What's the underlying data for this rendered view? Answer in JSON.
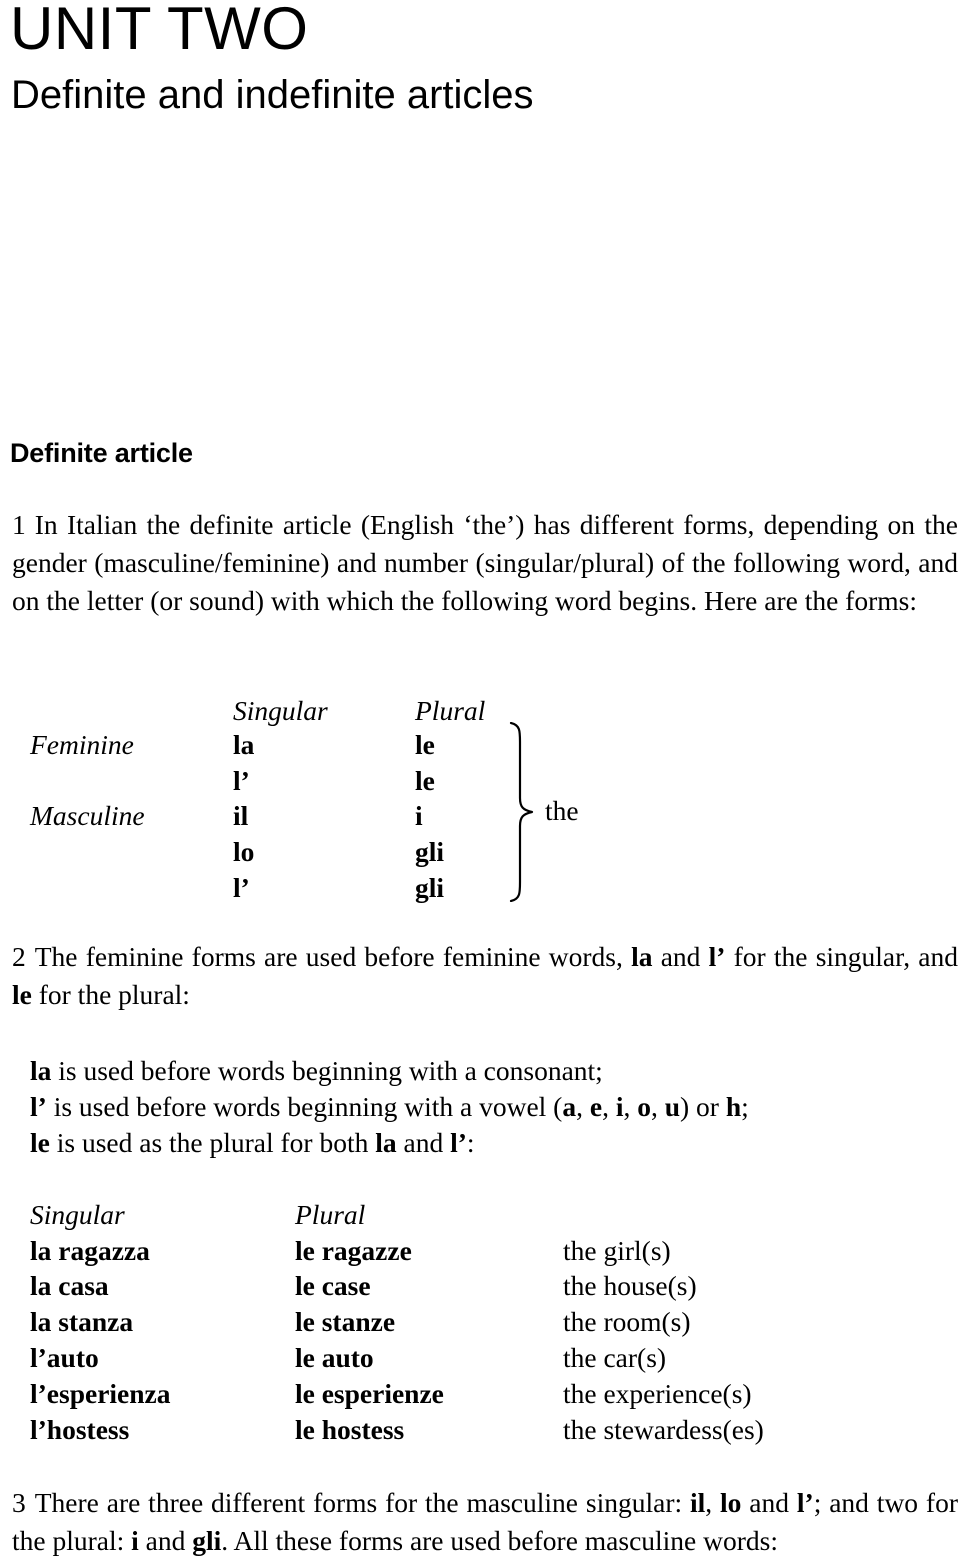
{
  "title": {
    "unit": "UNIT TWO",
    "subtitle": "Definite and indefinite articles"
  },
  "section": {
    "heading": "Definite article"
  },
  "paragraphs": {
    "p1": {
      "number": "1",
      "text": "In Italian the definite article (English ‘the’) has different forms, depending on the gender (masculine/feminine) and number (singular/plural) of the following word, and on the letter (or sound) with which the following word begins. Here are the forms:"
    },
    "p2": {
      "number": "2",
      "part1": "The feminine forms are used before feminine words, ",
      "b1": "la",
      "part2": " and ",
      "b2": "l’",
      "part3": " for the singular, and ",
      "b3": "le",
      "part4": " for the plural:"
    },
    "p3": {
      "number": "3",
      "part1": "There are three different forms for the masculine singular: ",
      "b1": "il",
      "part2": ", ",
      "b2": "lo",
      "part3": " and ",
      "b3": "l’",
      "part4": "; and two for the plural: ",
      "b4": "i",
      "part5": " and ",
      "b5": "gli",
      "part6": ". All these forms are used before masculine words:"
    }
  },
  "forms_table": {
    "header_singular": "Singular",
    "header_plural": "Plural",
    "rows": [
      {
        "label": "Feminine",
        "singular": "la",
        "plural": "le"
      },
      {
        "label": "",
        "singular": "l’",
        "plural": "le"
      },
      {
        "label": "Masculine",
        "singular": "il",
        "plural": "i"
      },
      {
        "label": "",
        "singular": "lo",
        "plural": "gli"
      },
      {
        "label": "",
        "singular": "l’",
        "plural": "gli"
      }
    ],
    "brace_label": "the"
  },
  "rules": {
    "line1": {
      "b1": "la",
      "t1": " is used before words beginning with a consonant;"
    },
    "line2": {
      "b1": "l’",
      "t1": " is used before words beginning with a vowel (",
      "b2": "a",
      "t2": ", ",
      "b3": "e",
      "t3": ", ",
      "b4": "i",
      "t4": ", ",
      "b5": "o",
      "t5": ", ",
      "b6": "u",
      "t6": ") or ",
      "b7": "h",
      "t7": ";"
    },
    "line3": {
      "b1": "le",
      "t1": " is used as the plural for both ",
      "b2": "la",
      "t2": " and ",
      "b3": "l’",
      "t3": ":"
    }
  },
  "examples_table": {
    "header_singular": "Singular",
    "header_plural": "Plural",
    "rows": [
      {
        "singular": "la ragazza",
        "plural": "le ragazze",
        "english": "the girl(s)"
      },
      {
        "singular": "la casa",
        "plural": "le case",
        "english": "the house(s)"
      },
      {
        "singular": "la stanza",
        "plural": "le stanze",
        "english": "the room(s)"
      },
      {
        "singular": "l’auto",
        "plural": "le auto",
        "english": "the car(s)"
      },
      {
        "singular": "l’esperienza",
        "plural": "le esperienze",
        "english": "the experience(s)"
      },
      {
        "singular": "l’hostess",
        "plural": "le hostess",
        "english": "the stewardess(es)"
      }
    ]
  }
}
